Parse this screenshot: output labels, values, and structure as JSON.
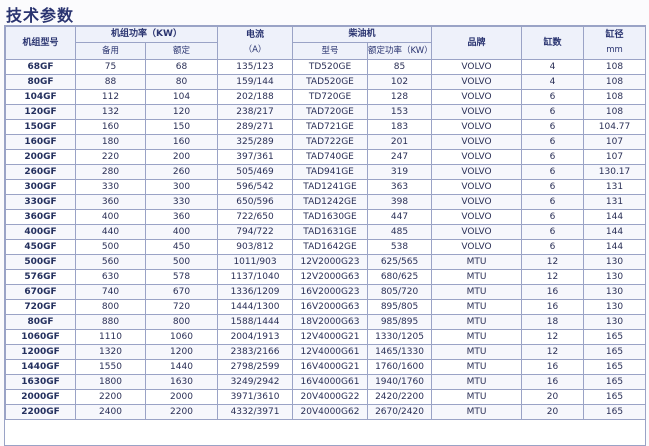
{
  "title": "技术参数",
  "headers": {
    "model": "机组型号",
    "unit_power": "机组功率（KW）",
    "standby": "备用",
    "rated": "额定",
    "current": "电流",
    "current_unit": "（A）",
    "diesel_engine": "柴油机",
    "engine_model": "型号",
    "engine_rated_power": "额定功率（KW）",
    "brand": "品牌",
    "cylinders": "缸数",
    "bore": "缸径",
    "bore_unit": "mm"
  },
  "rows": [
    {
      "model": "68GF",
      "standby": "75",
      "rated": "68",
      "current": "135/123",
      "engine": "TD520GE",
      "engine_power": "85",
      "brand": "VOLVO",
      "cylinders": "4",
      "bore": "108"
    },
    {
      "model": "80GF",
      "standby": "88",
      "rated": "80",
      "current": "159/144",
      "engine": "TAD520GE",
      "engine_power": "102",
      "brand": "VOLVO",
      "cylinders": "4",
      "bore": "108"
    },
    {
      "model": "104GF",
      "standby": "112",
      "rated": "104",
      "current": "202/188",
      "engine": "TD720GE",
      "engine_power": "128",
      "brand": "VOLVO",
      "cylinders": "6",
      "bore": "108"
    },
    {
      "model": "120GF",
      "standby": "132",
      "rated": "120",
      "current": "238/217",
      "engine": "TAD720GE",
      "engine_power": "153",
      "brand": "VOLVO",
      "cylinders": "6",
      "bore": "108"
    },
    {
      "model": "150GF",
      "standby": "160",
      "rated": "150",
      "current": "289/271",
      "engine": "TAD721GE",
      "engine_power": "183",
      "brand": "VOLVO",
      "cylinders": "6",
      "bore": "104.77"
    },
    {
      "model": "160GF",
      "standby": "180",
      "rated": "160",
      "current": "325/289",
      "engine": "TAD722GE",
      "engine_power": "201",
      "brand": "VOLVO",
      "cylinders": "6",
      "bore": "107"
    },
    {
      "model": "200GF",
      "standby": "220",
      "rated": "200",
      "current": "397/361",
      "engine": "TAD740GE",
      "engine_power": "247",
      "brand": "VOLVO",
      "cylinders": "6",
      "bore": "107"
    },
    {
      "model": "260GF",
      "standby": "280",
      "rated": "260",
      "current": "505/469",
      "engine": "TAD941GE",
      "engine_power": "319",
      "brand": "VOLVO",
      "cylinders": "6",
      "bore": "130.17"
    },
    {
      "model": "300GF",
      "standby": "330",
      "rated": "300",
      "current": "596/542",
      "engine": "TAD1241GE",
      "engine_power": "363",
      "brand": "VOLVO",
      "cylinders": "6",
      "bore": "131"
    },
    {
      "model": "330GF",
      "standby": "360",
      "rated": "330",
      "current": "650/596",
      "engine": "TAD1242GE",
      "engine_power": "398",
      "brand": "VOLVO",
      "cylinders": "6",
      "bore": "131"
    },
    {
      "model": "360GF",
      "standby": "400",
      "rated": "360",
      "current": "722/650",
      "engine": "TAD1630GE",
      "engine_power": "447",
      "brand": "VOLVO",
      "cylinders": "6",
      "bore": "144"
    },
    {
      "model": "400GF",
      "standby": "440",
      "rated": "400",
      "current": "794/722",
      "engine": "TAD1631GE",
      "engine_power": "485",
      "brand": "VOLVO",
      "cylinders": "6",
      "bore": "144"
    },
    {
      "model": "450GF",
      "standby": "500",
      "rated": "450",
      "current": "903/812",
      "engine": "TAD1642GE",
      "engine_power": "538",
      "brand": "VOLVO",
      "cylinders": "6",
      "bore": "144"
    },
    {
      "model": "500GF",
      "standby": "560",
      "rated": "500",
      "current": "1011/903",
      "engine": "12V2000G23",
      "engine_power": "625/565",
      "brand": "MTU",
      "cylinders": "12",
      "bore": "130"
    },
    {
      "model": "576GF",
      "standby": "630",
      "rated": "578",
      "current": "1137/1040",
      "engine": "12V2000G63",
      "engine_power": "680/625",
      "brand": "MTU",
      "cylinders": "12",
      "bore": "130"
    },
    {
      "model": "670GF",
      "standby": "740",
      "rated": "670",
      "current": "1336/1209",
      "engine": "16V2000G23",
      "engine_power": "805/720",
      "brand": "MTU",
      "cylinders": "16",
      "bore": "130"
    },
    {
      "model": "720GF",
      "standby": "800",
      "rated": "720",
      "current": "1444/1300",
      "engine": "16V2000G63",
      "engine_power": "895/805",
      "brand": "MTU",
      "cylinders": "16",
      "bore": "130"
    },
    {
      "model": "80GF",
      "standby": "880",
      "rated": "800",
      "current": "1588/1444",
      "engine": "18V2000G63",
      "engine_power": "985/895",
      "brand": "MTU",
      "cylinders": "18",
      "bore": "130"
    },
    {
      "model": "1060GF",
      "standby": "1110",
      "rated": "1060",
      "current": "2004/1913",
      "engine": "12V4000G21",
      "engine_power": "1330/1205",
      "brand": "MTU",
      "cylinders": "12",
      "bore": "165"
    },
    {
      "model": "1200GF",
      "standby": "1320",
      "rated": "1200",
      "current": "2383/2166",
      "engine": "12V4000G61",
      "engine_power": "1465/1330",
      "brand": "MTU",
      "cylinders": "12",
      "bore": "165"
    },
    {
      "model": "1440GF",
      "standby": "1550",
      "rated": "1440",
      "current": "2798/2599",
      "engine": "16V4000G21",
      "engine_power": "1760/1600",
      "brand": "MTU",
      "cylinders": "16",
      "bore": "165"
    },
    {
      "model": "1630GF",
      "standby": "1800",
      "rated": "1630",
      "current": "3249/2942",
      "engine": "16V4000G61",
      "engine_power": "1940/1760",
      "brand": "MTU",
      "cylinders": "16",
      "bore": "165"
    },
    {
      "model": "2000GF",
      "standby": "2200",
      "rated": "2000",
      "current": "3971/3610",
      "engine": "20V4000G22",
      "engine_power": "2420/2200",
      "brand": "MTU",
      "cylinders": "20",
      "bore": "165"
    },
    {
      "model": "2200GF",
      "standby": "2400",
      "rated": "2200",
      "current": "4332/3971",
      "engine": "20V4000G62",
      "engine_power": "2670/2420",
      "brand": "MTU",
      "cylinders": "20",
      "bore": "165"
    }
  ]
}
